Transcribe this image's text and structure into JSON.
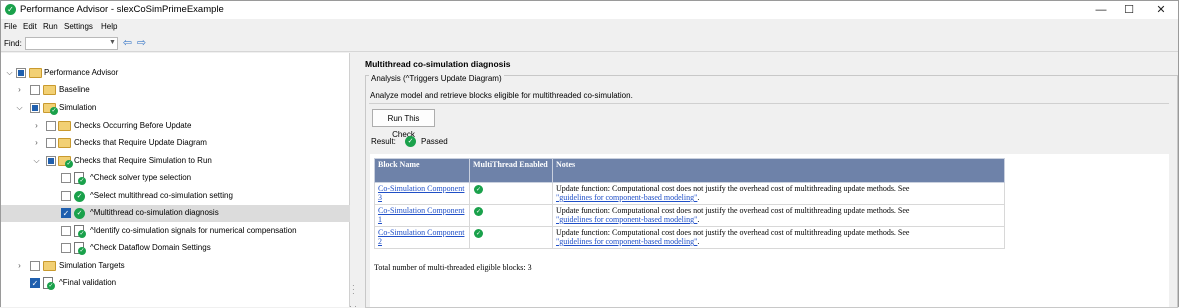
{
  "window": {
    "title": "Performance Advisor - slexCoSimPrimeExample",
    "controls": {
      "minimize": "—",
      "maximize": "☐",
      "close": "✕"
    }
  },
  "menu": {
    "items": [
      "File",
      "Edit",
      "Run",
      "Settings",
      "Help"
    ]
  },
  "find": {
    "label": "Find:",
    "value": ""
  },
  "tree": {
    "root": "Performance Advisor",
    "baseline": "Baseline",
    "simulation": "Simulation",
    "checks_before_update": "Checks Occurring Before Update",
    "checks_require_update": "Checks that Require Update Diagram",
    "checks_require_sim": "Checks that Require Simulation to Run",
    "check_solver": "^Check solver type selection",
    "select_multithread": "^Select multithread co-simulation setting",
    "multithread_diag": "^Multithread co-simulation diagnosis",
    "identify_signals": "^Identify co-simulation signals for numerical compensation",
    "check_dataflow": "^Check Dataflow Domain Settings",
    "sim_targets": "Simulation Targets",
    "final_validation": "^Final validation"
  },
  "detail": {
    "title": "Multithread co-simulation diagnosis",
    "group_legend": "Analysis (^Triggers Update Diagram)",
    "description": "Analyze model and retrieve blocks eligible for multithreaded co-simulation.",
    "run_button": "Run This Check",
    "result_label": "Result:",
    "result_value": "Passed"
  },
  "report": {
    "headers": {
      "block": "Block Name",
      "mt": "MultiThread Enabled",
      "notes": "Notes"
    },
    "rows": [
      {
        "block": "Co-Simulation Component 3",
        "note": "Update function: Computational cost does not justify the overhead cost of multithreading update methods. See",
        "link": "\"guidelines for component-based modeling\"",
        "suffix": "."
      },
      {
        "block": "Co-Simulation Component 1",
        "note": "Update function: Computational cost does not justify the overhead cost of multithreading update methods. See",
        "link": "\"guidelines for component-based modeling\"",
        "suffix": "."
      },
      {
        "block": "Co-Simulation Component 2",
        "note": "Update function: Computational cost does not justify the overhead cost of multithreading update methods. See",
        "link": "\"guidelines for component-based modeling\"",
        "suffix": "."
      }
    ],
    "total": "Total number of multi-threaded eligible blocks: 3"
  },
  "colors": {
    "pass": "#1aa14b",
    "header_bg": "#6e82a9",
    "link": "#1f4fc7",
    "selection": "#dcdcdc"
  },
  "icons": [
    "app-icon",
    "folder-icon",
    "check-doc-icon",
    "pass-icon",
    "back-arrow-icon",
    "forward-arrow-icon"
  ]
}
